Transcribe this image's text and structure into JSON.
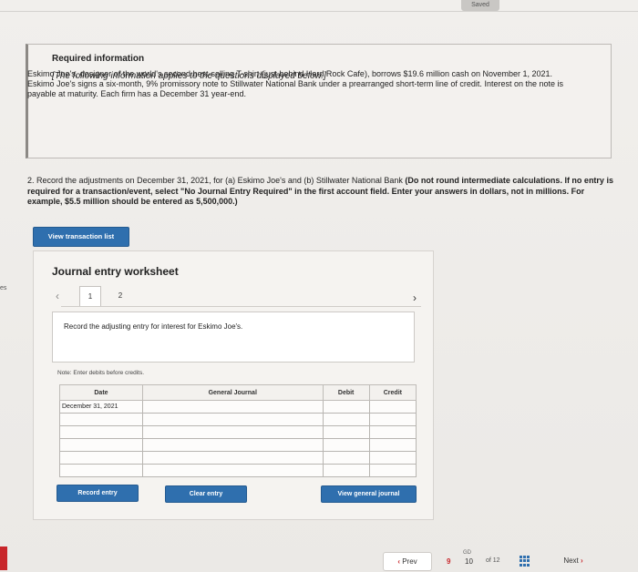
{
  "header": {
    "saved_label": "Saved",
    "side_cut_label": "es"
  },
  "info": {
    "title": "Required information",
    "subtitle": "[The following information applies to the questions displayed below.]",
    "body": "Eskimo Joe's, designer of the world's second best-selling T-shirt (just behind Hard Rock Cafe), borrows $19.6 million cash on November 1, 2021. Eskimo Joe's signs a six-month, 9% promissory note to Stillwater National Bank under a prearranged short-term line of credit. Interest on the note is payable at maturity. Each firm has a December 31 year-end."
  },
  "question": {
    "lead": "2. Record the adjustments on December 31, 2021, for (a) Eskimo Joe's and (b) Stillwater National Bank ",
    "bold": "(Do not round intermediate calculations. If no entry is required for a transaction/event, select \"No Journal Entry Required\" in the first account field. Enter your answers in dollars, not in millions. For example, $5.5 million should be entered as 5,500,000.)"
  },
  "buttons": {
    "view_transaction_list": "View transaction list",
    "record_entry": "Record entry",
    "clear_entry": "Clear entry",
    "view_general_journal": "View general journal"
  },
  "worksheet": {
    "title": "Journal entry worksheet",
    "tabs": [
      "1",
      "2"
    ],
    "instruction": "Record the adjusting entry for interest for Eskimo Joe's.",
    "note": "Note: Enter debits before credits.",
    "columns": {
      "date": "Date",
      "general_journal": "General Journal",
      "debit": "Debit",
      "credit": "Credit"
    },
    "rows": [
      {
        "date": "December 31, 2021"
      },
      {
        "date": ""
      },
      {
        "date": ""
      },
      {
        "date": ""
      },
      {
        "date": ""
      },
      {
        "date": ""
      }
    ]
  },
  "footer": {
    "prev_label": "Prev",
    "next_label": "Next",
    "pages": {
      "prev_page": "9",
      "current": "10",
      "of": "of 12",
      "current_mark": "GD"
    }
  },
  "colors": {
    "accent": "#2f6fae",
    "brand_red": "#c8262b"
  }
}
